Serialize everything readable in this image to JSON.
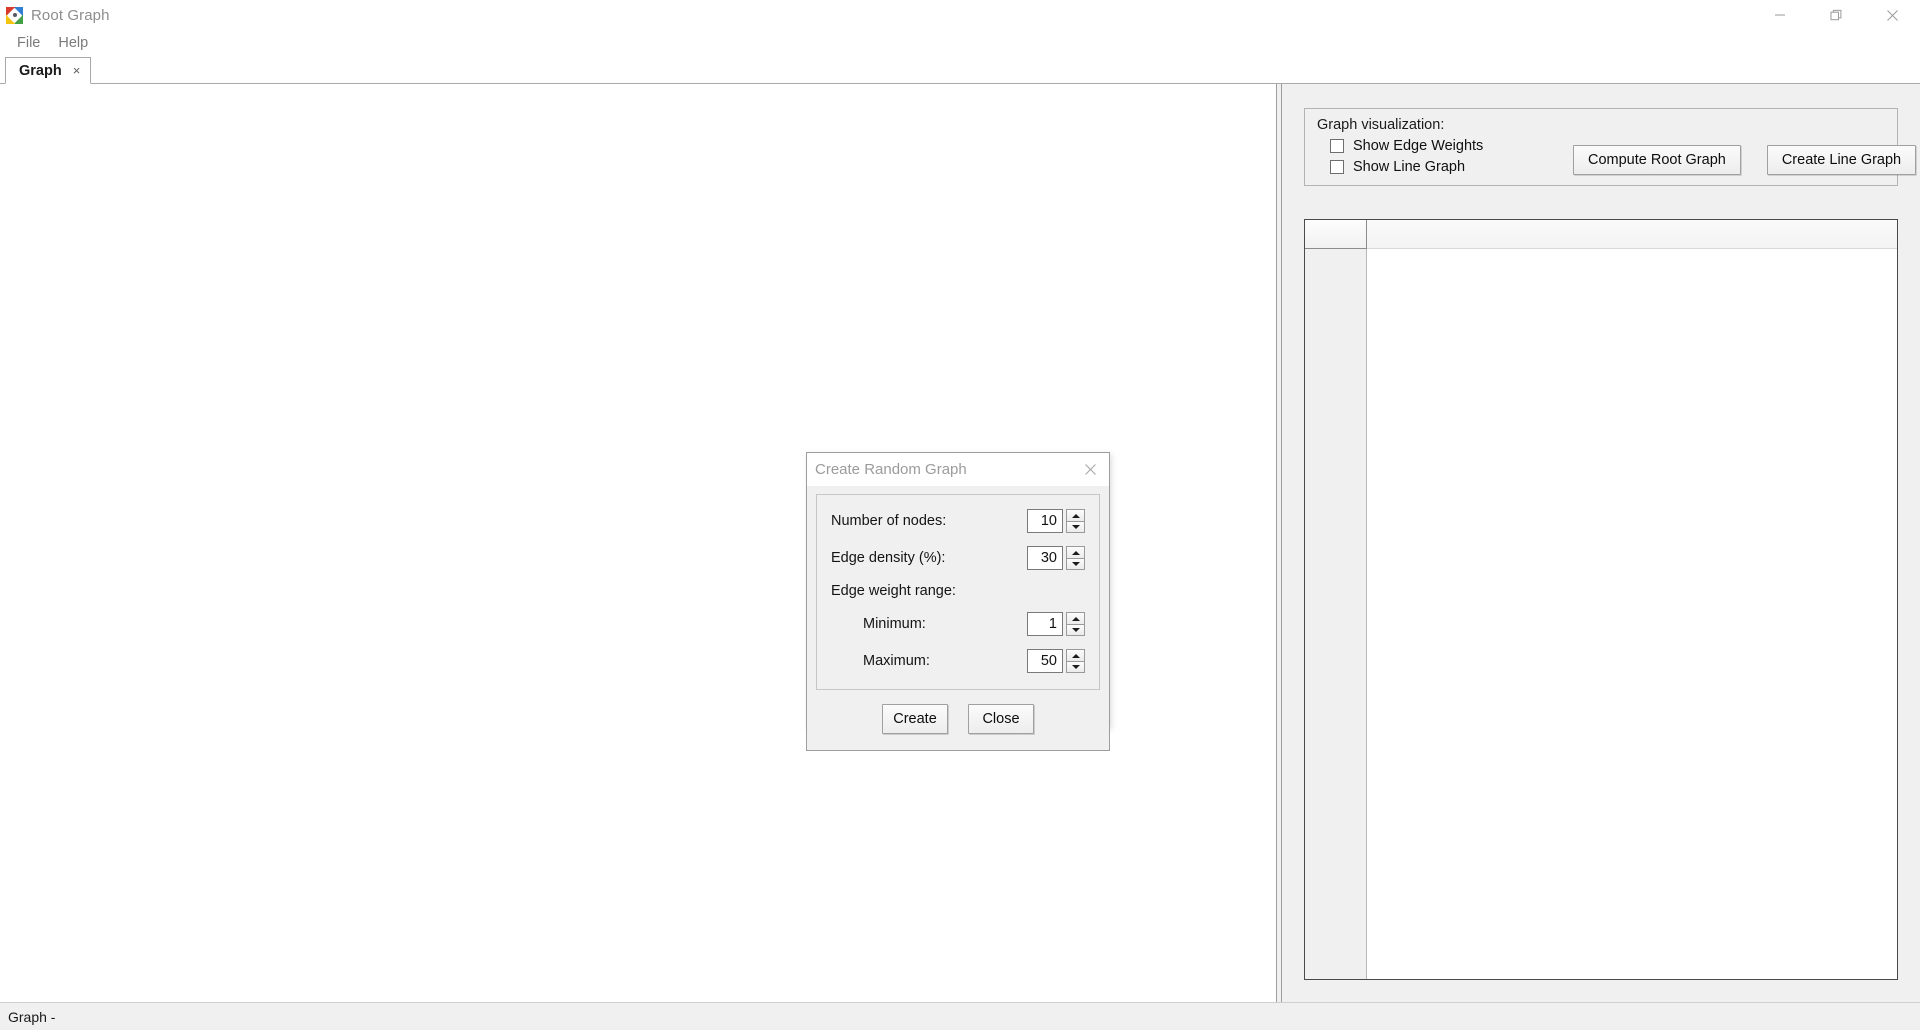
{
  "window": {
    "title": "Root Graph",
    "icon": "root-graph-app-icon",
    "controls": {
      "minimize": "minimize-icon",
      "restore": "restore-icon",
      "close": "close-icon"
    }
  },
  "menubar": {
    "items": [
      {
        "label": "File"
      },
      {
        "label": "Help"
      }
    ]
  },
  "tabs": [
    {
      "label": "Graph",
      "close": "×",
      "active": true
    }
  ],
  "side_panel": {
    "groupbox": {
      "title": "Graph visualization:",
      "checkboxes": [
        {
          "label": "Show Edge Weights",
          "checked": false
        },
        {
          "label": "Show Line Graph",
          "checked": false
        }
      ],
      "buttons": [
        {
          "label": "Compute Root Graph"
        },
        {
          "label": "Create Line Graph"
        }
      ]
    },
    "table": {
      "corner_cell": "",
      "column_headers": [],
      "row_headers": [],
      "rows": []
    }
  },
  "statusbar": {
    "text": "Graph  -"
  },
  "dialog": {
    "title": "Create Random Graph",
    "close_icon": "close-icon",
    "fields": [
      {
        "label": "Number of nodes:",
        "value": "10",
        "indent": false
      },
      {
        "label": "Edge density (%):",
        "value": "30",
        "indent": false
      }
    ],
    "section_label": "Edge weight range:",
    "range_fields": [
      {
        "label": "Minimum:",
        "value": "1",
        "indent": true
      },
      {
        "label": "Maximum:",
        "value": "50",
        "indent": true
      }
    ],
    "buttons": [
      {
        "label": "Create"
      },
      {
        "label": "Close"
      }
    ]
  },
  "colors": {
    "panel_bg": "#f0f0f0",
    "canvas_bg": "#ffffff",
    "border": "#a9a9a9",
    "text": "#101010",
    "muted_text": "#8d8d8d"
  }
}
